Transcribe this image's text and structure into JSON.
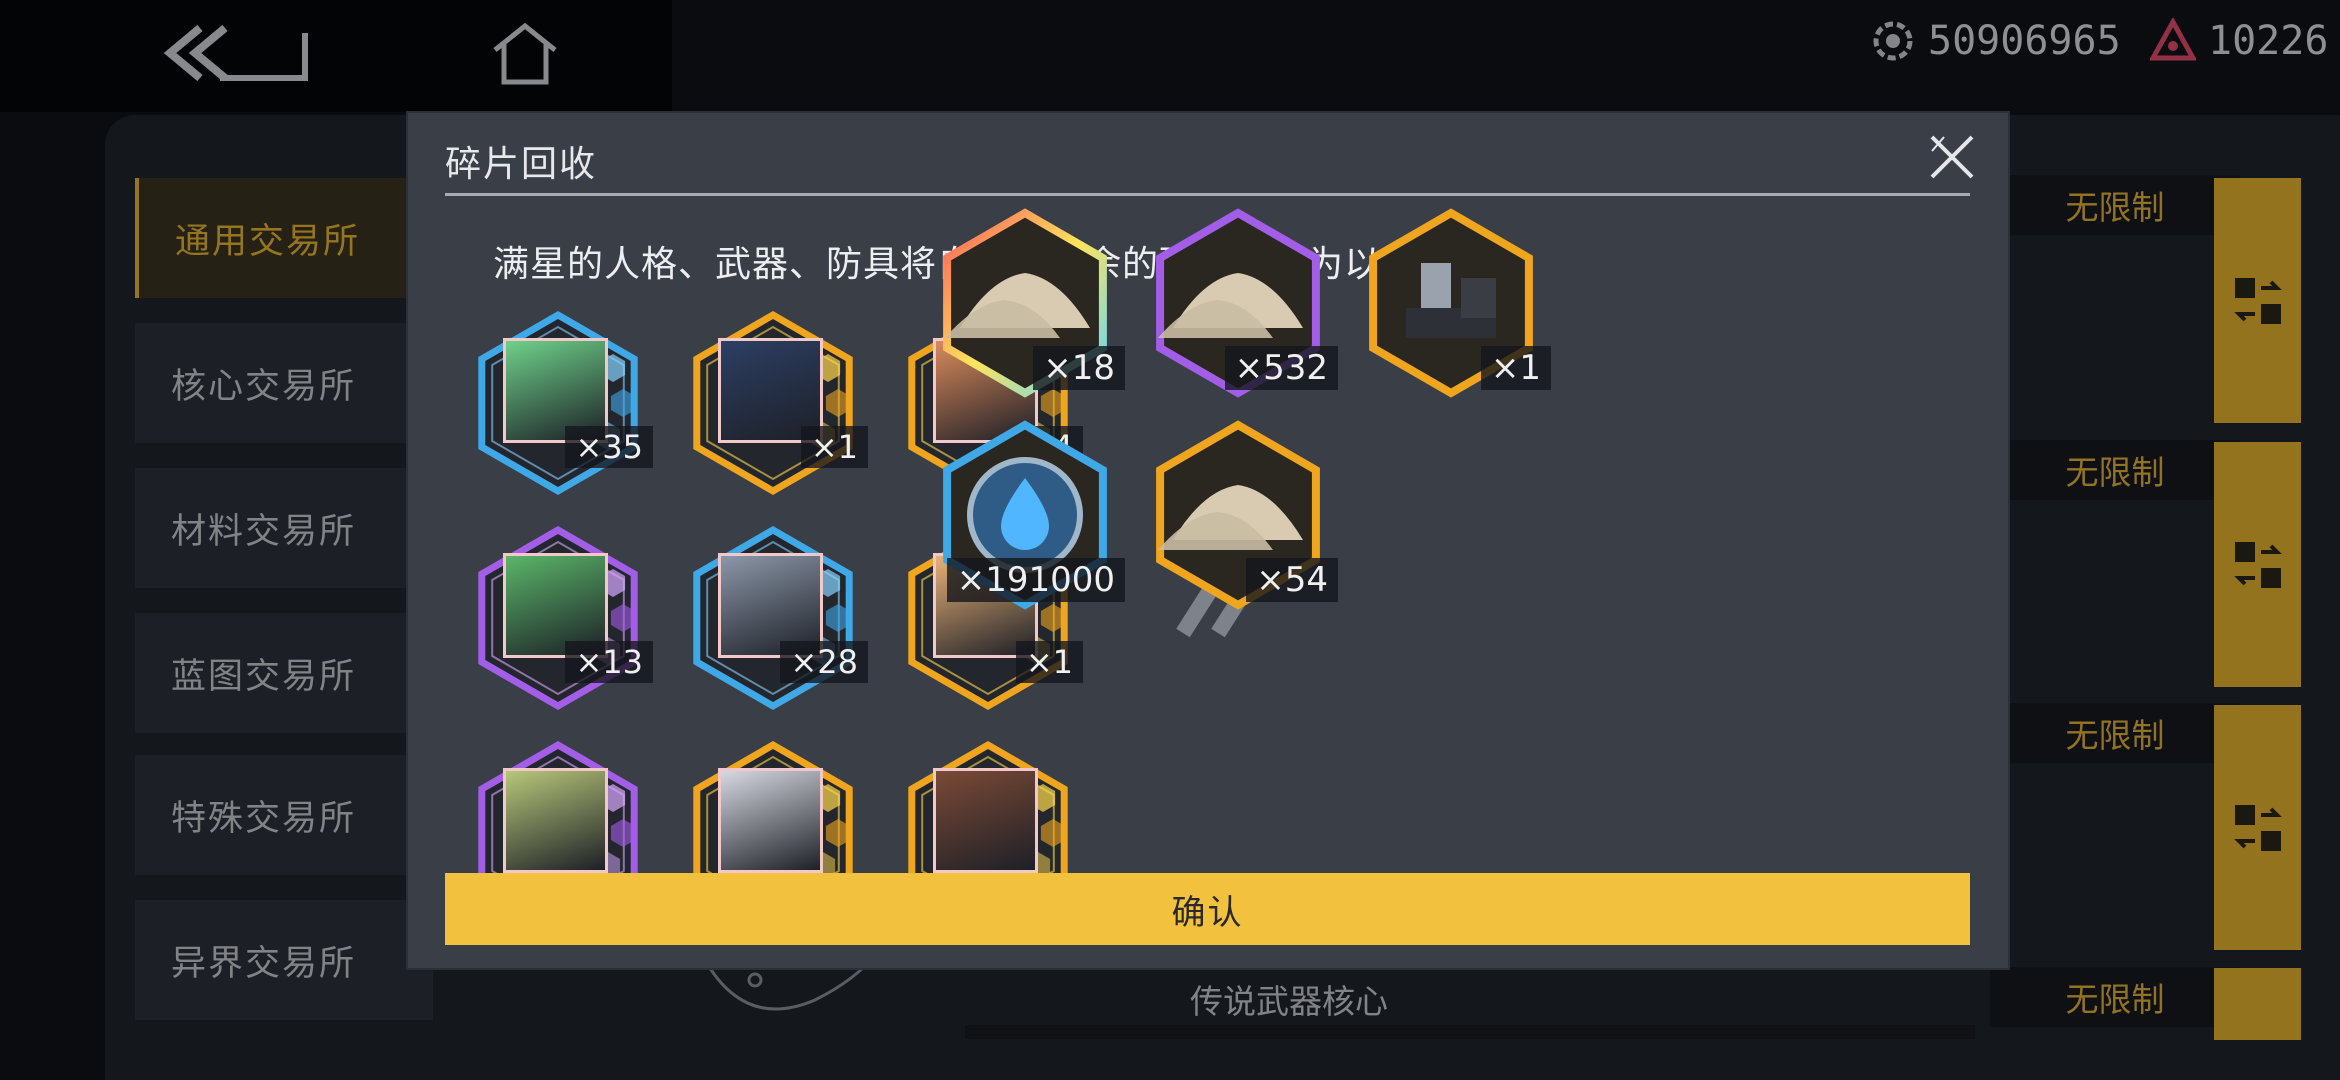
{
  "resources": [
    {
      "icon": "eye-gear-icon",
      "value": "50906965"
    },
    {
      "icon": "warning-triangle-icon",
      "value": "10226"
    }
  ],
  "side_menu": [
    {
      "label": "通用交易所",
      "active": true
    },
    {
      "label": "核心交易所",
      "active": false
    },
    {
      "label": "材料交易所",
      "active": false
    },
    {
      "label": "蓝图交易所",
      "active": false
    },
    {
      "label": "特殊交易所",
      "active": false
    },
    {
      "label": "异界交易所",
      "active": false
    }
  ],
  "shop_rows": [
    {
      "limit": "无限制"
    },
    {
      "limit": "无限制"
    },
    {
      "limit": "无限制"
    },
    {
      "limit": "无限制"
    }
  ],
  "bottom_row_title": "传说武器核心",
  "modal": {
    "title": "碎片回收",
    "description": "满星的人格、武器、防具将自动把多余的碎片分解为以下材料",
    "fragments": [
      {
        "count": "×35",
        "rarity": "blue",
        "portrait": "#6fd18a"
      },
      {
        "count": "×1",
        "rarity": "gold",
        "portrait": "#2d3f63"
      },
      {
        "count": "×4",
        "rarity": "gold",
        "portrait": "#d98a5c"
      },
      {
        "count": "×13",
        "rarity": "purple",
        "portrait": "#5bb56a"
      },
      {
        "count": "×28",
        "rarity": "blue",
        "portrait": "#8c97a8"
      },
      {
        "count": "×1",
        "rarity": "gold",
        "portrait": "#e8b27a"
      },
      {
        "count": "",
        "rarity": "purple",
        "portrait": "#b7c77a"
      },
      {
        "count": "",
        "rarity": "gold",
        "portrait": "#d7d9e2"
      },
      {
        "count": "",
        "rarity": "gold",
        "portrait": "#7a4a36"
      }
    ],
    "materials": [
      {
        "count": "×18",
        "rarity": "rainbow"
      },
      {
        "count": "×532",
        "rarity": "purple"
      },
      {
        "count": "×1",
        "rarity": "gold"
      },
      {
        "count": "×191000",
        "rarity": "blue"
      },
      {
        "count": "×54",
        "rarity": "gold"
      }
    ],
    "confirm_label": "确认"
  },
  "colors": {
    "accent": "#f2c23e",
    "rarity_blue": "#3fa9e8",
    "rarity_gold": "#f0a51e",
    "rarity_purple": "#a35ee8"
  }
}
